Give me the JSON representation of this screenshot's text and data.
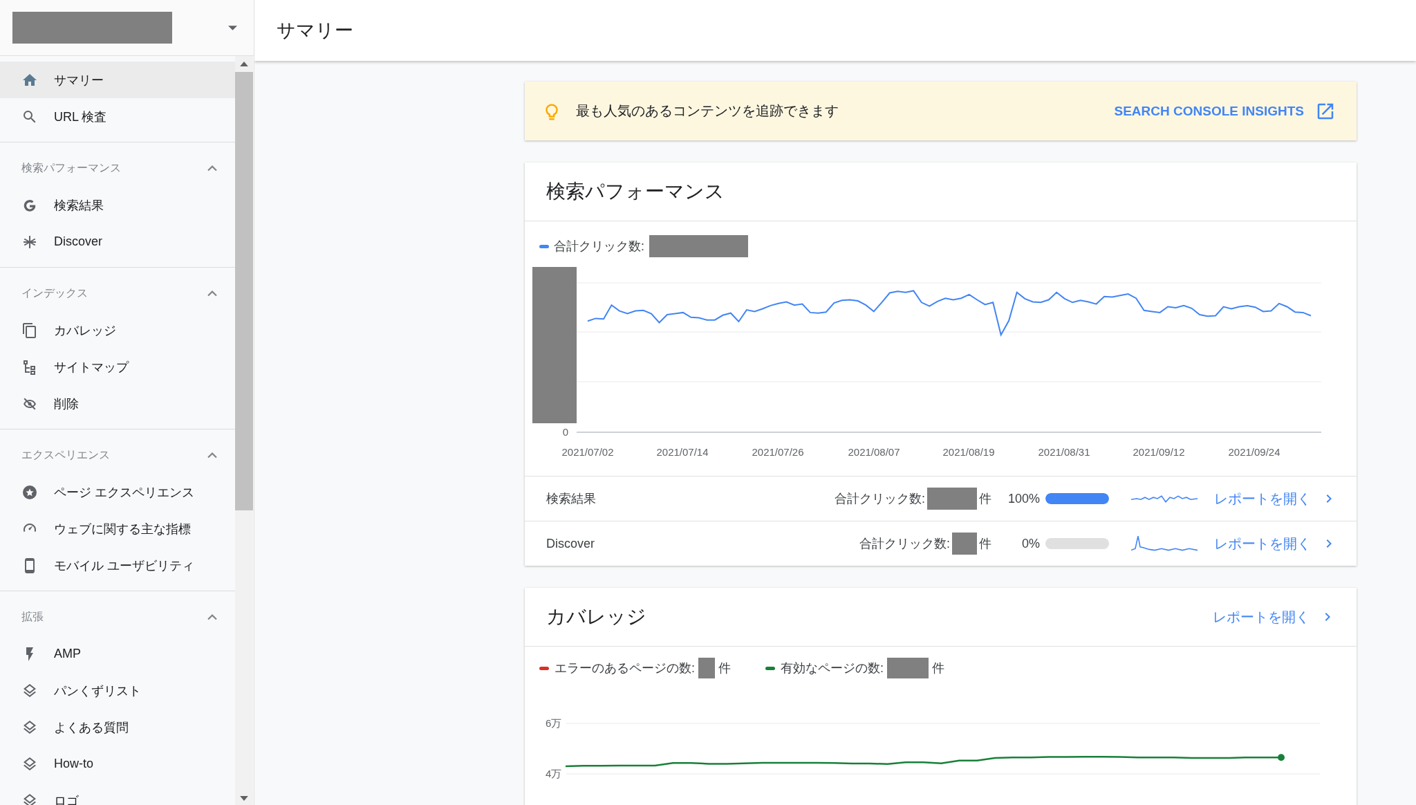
{
  "page_title": "サマリー",
  "sidebar": {
    "items": [
      {
        "label": "サマリー",
        "selected": true
      },
      {
        "label": "URL 検査",
        "selected": false
      }
    ],
    "sections": [
      {
        "title": "検索パフォーマンス",
        "expanded": true,
        "items": [
          {
            "label": "検索結果",
            "selected": false
          },
          {
            "label": "Discover",
            "selected": false
          }
        ]
      },
      {
        "title": "インデックス",
        "expanded": true,
        "items": [
          {
            "label": "カバレッジ",
            "selected": false
          },
          {
            "label": "サイトマップ",
            "selected": false
          },
          {
            "label": "削除",
            "selected": false
          }
        ]
      },
      {
        "title": "エクスペリエンス",
        "expanded": true,
        "items": [
          {
            "label": "ページ エクスペリエンス",
            "selected": false
          },
          {
            "label": "ウェブに関する主な指標",
            "selected": false
          },
          {
            "label": "モバイル ユーザビリティ",
            "selected": false
          }
        ]
      },
      {
        "title": "拡張",
        "expanded": true,
        "items": [
          {
            "label": "AMP",
            "selected": false
          },
          {
            "label": "パンくずリスト",
            "selected": false
          },
          {
            "label": "よくある質問",
            "selected": false
          },
          {
            "label": "How-to",
            "selected": false
          },
          {
            "label": "ロゴ",
            "selected": false
          }
        ]
      }
    ]
  },
  "banner": {
    "text": "最も人気のあるコンテンツを追跡できます",
    "link": "SEARCH CONSOLE INSIGHTS"
  },
  "performance": {
    "title": "検索パフォーマンス",
    "legend": "合計クリック数:",
    "y_zero": "0",
    "dates": [
      "2021/07/02",
      "2021/07/14",
      "2021/07/26",
      "2021/08/07",
      "2021/08/19",
      "2021/08/31",
      "2021/09/12",
      "2021/09/24"
    ],
    "rows": [
      {
        "name": "検索結果",
        "metric_label": "合計クリック数:",
        "unit": "件",
        "percent": "100%",
        "level": 1,
        "link": "レポートを開く"
      },
      {
        "name": "Discover",
        "metric_label": "合計クリック数:",
        "unit": "件",
        "percent": "0%",
        "level": 0,
        "link": "レポートを開く"
      }
    ]
  },
  "coverage": {
    "title": "カバレッジ",
    "link": "レポートを開く",
    "legend": [
      {
        "label": "エラーのあるページの数:",
        "unit": "件",
        "color": "#d93025"
      },
      {
        "label": "有効なページの数:",
        "unit": "件",
        "color": "#188038"
      }
    ],
    "chart_data": {
      "type": "line",
      "ylim": [
        4,
        6
      ],
      "yticks": [
        {
          "value": 4,
          "label": "4万"
        },
        {
          "value": 6,
          "label": "6万"
        }
      ],
      "series": [
        {
          "color": "#188038",
          "values": [
            4.3,
            4.32,
            4.32,
            4.33,
            4.33,
            4.33,
            4.43,
            4.43,
            4.4,
            4.4,
            4.42,
            4.44,
            4.44,
            4.44,
            4.44,
            4.43,
            4.41,
            4.41,
            4.39,
            4.46,
            4.46,
            4.42,
            4.53,
            4.53,
            4.63,
            4.65,
            4.65,
            4.67,
            4.67,
            4.68,
            4.68,
            4.67,
            4.65,
            4.65,
            4.65,
            4.63,
            4.63,
            4.63,
            4.65,
            4.65,
            4.65
          ]
        }
      ]
    }
  }
}
